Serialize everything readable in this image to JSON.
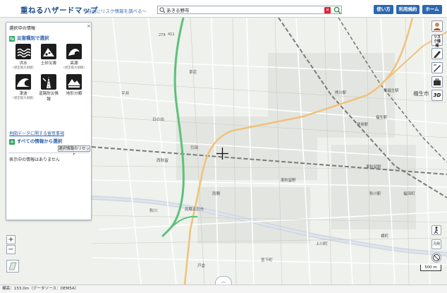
{
  "header": {
    "title": "重ねるハザードマップ",
    "subtitle": "〜自由にリスク情報を調べる〜",
    "search_value": "あきる野市",
    "buttons": {
      "howto": "使い方",
      "terms": "利用規約",
      "home": "ホーム"
    }
  },
  "panel": {
    "title": "選択中の情報",
    "close": "×",
    "by_type_header": "災害種別で選択",
    "hazards": [
      {
        "label": "洪水",
        "note": "(想定最大規模)",
        "icon": "flood-icon"
      },
      {
        "label": "土砂災害",
        "note": "",
        "icon": "landslide-icon"
      },
      {
        "label": "高潮",
        "note": "(想定最大規模)",
        "icon": "storm-surge-icon"
      },
      {
        "label": "津波",
        "note": "(想定最大規模)",
        "icon": "tsunami-icon"
      },
      {
        "label": "道路防災情報",
        "note": "",
        "icon": "road-icon"
      },
      {
        "label": "地形分類",
        "note": "",
        "icon": "terrain-icon"
      }
    ],
    "link": "地図データに関する留意事項",
    "all_info_header": "すべての情報から選択",
    "reset": "選択情報のリセット",
    "message": "表示中の情報はありません"
  },
  "map": {
    "labels": {
      "fukuo": "福生市",
      "fukuo_station": "福生駅",
      "higashi_fukuo": "東福生駅",
      "kumagawa": "熊川駅",
      "haijima": "拝島駅",
      "higashi_akiru": "東秋留駅",
      "akigawa": "秋川駅",
      "musashi_itsukaichi": "武蔵五日市",
      "higashi_akiruno": "東秋留野",
      "hirai": "平井",
      "kusahana": "草花",
      "hinode": "日の出",
      "amata": "雨間",
      "akigawa_river": "秋川",
      "tokura": "戸倉",
      "route": "279",
      "hikada": "引田",
      "nishi_akiru": "西秋留",
      "miyashita": "宮下町",
      "kamikawa": "上川町",
      "yokomachi": "横町",
      "fukuda": "福田町",
      "route_411": "411"
    },
    "scale": "500 m",
    "zoom_in": "+",
    "zoom_out": "−",
    "collapse": "︿"
  },
  "tools": {
    "risk": "リスク情報",
    "sample": "凡例"
  },
  "status": "標高：153.0m（データソース：DEM5A）",
  "colors": {
    "header_blue": "#2b66b1",
    "title_blue": "#1f4f8f",
    "expressway": "#5cc17a",
    "major_road": "#f0c27a"
  }
}
